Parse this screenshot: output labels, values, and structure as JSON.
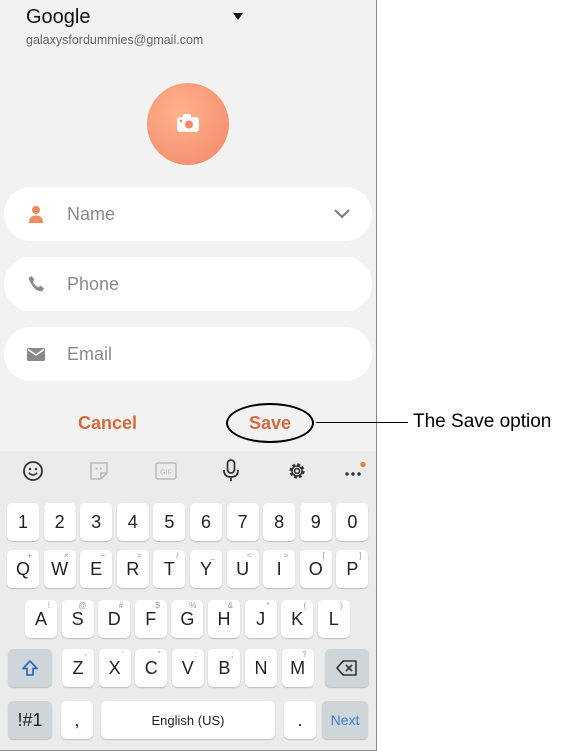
{
  "account": {
    "name": "Google",
    "email": "galaxysfordummies@gmail.com"
  },
  "fields": [
    {
      "placeholder": "Name",
      "icon": "person-icon"
    },
    {
      "placeholder": "Phone",
      "icon": "phone-icon"
    },
    {
      "placeholder": "Email",
      "icon": "email-icon"
    }
  ],
  "actions": {
    "cancel": "Cancel",
    "save": "Save"
  },
  "annotation": "The Save option",
  "keyboard": {
    "toolbar": [
      "emoji-icon",
      "sticker-icon",
      "gif-icon",
      "microphone-icon",
      "settings-icon",
      "more-icon"
    ],
    "gif_label": "GIF",
    "numbers": [
      "1",
      "2",
      "3",
      "4",
      "5",
      "6",
      "7",
      "8",
      "9",
      "0"
    ],
    "row1": [
      "Q",
      "W",
      "E",
      "R",
      "T",
      "Y",
      "U",
      "I",
      "O",
      "P"
    ],
    "row1_hints": [
      "+",
      "×",
      "÷",
      "=",
      "/",
      "_",
      "<",
      ">",
      "[",
      "]"
    ],
    "row2": [
      "A",
      "S",
      "D",
      "F",
      "G",
      "H",
      "J",
      "K",
      "L"
    ],
    "row2_hints": [
      "!",
      "@",
      "#",
      "$",
      "%",
      "&",
      "*",
      "(",
      ")"
    ],
    "row3": [
      "Z",
      "X",
      "C",
      "V",
      "B",
      "N",
      "M"
    ],
    "row3_hints": [
      "-",
      "'",
      "\"",
      ":",
      ";",
      ",",
      "?"
    ],
    "symbols": "!#1",
    "comma": ",",
    "space": "English (US)",
    "period": ".",
    "next": "Next"
  },
  "colors": {
    "accent": "#d5693e",
    "avatar": "#f2876a",
    "next_key_text": "#3e7fd1"
  }
}
